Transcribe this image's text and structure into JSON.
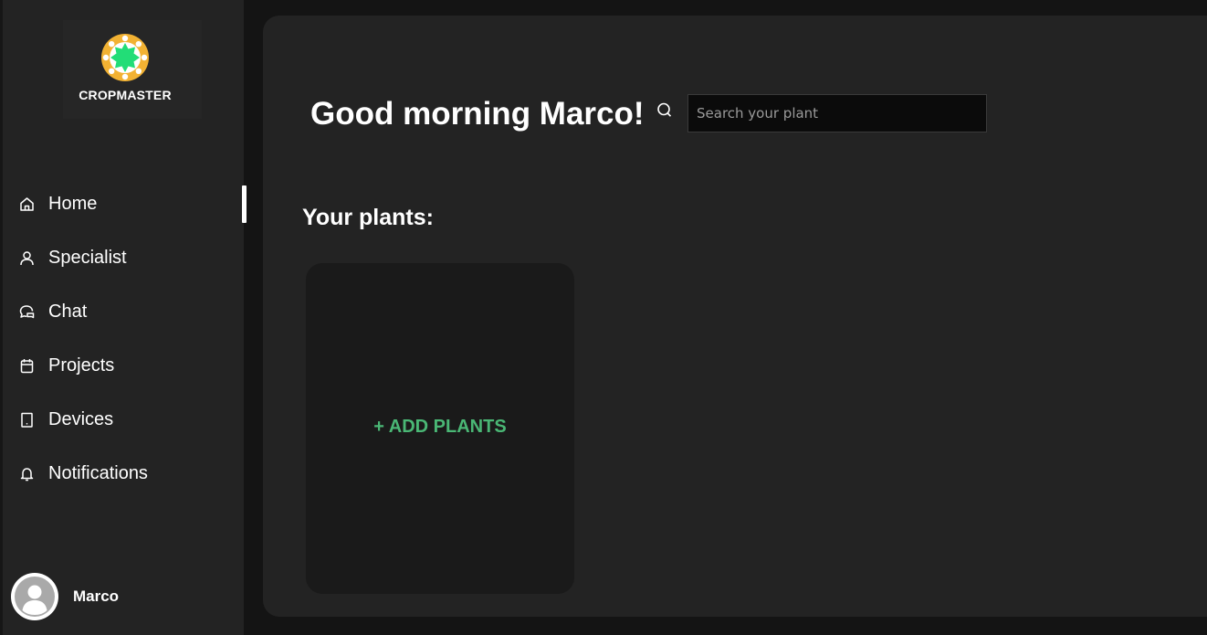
{
  "brand": {
    "name": "CROPMASTER",
    "logo_icon": "sun-flower-logo",
    "colors": {
      "outer": "#f2b233",
      "inner": "#22dd77",
      "ring": "#ffffff"
    }
  },
  "sidebar": {
    "items": [
      {
        "label": "Home",
        "icon": "home-icon",
        "active": true
      },
      {
        "label": "Specialist",
        "icon": "person-icon",
        "active": false
      },
      {
        "label": "Chat",
        "icon": "chat-icon",
        "active": false
      },
      {
        "label": "Projects",
        "icon": "calendar-icon",
        "active": false
      },
      {
        "label": "Devices",
        "icon": "tablet-icon",
        "active": false
      },
      {
        "label": "Notifications",
        "icon": "bell-icon",
        "active": false
      }
    ]
  },
  "user": {
    "name": "Marco",
    "avatar_icon": "user-avatar-icon"
  },
  "header": {
    "greeting": "Good morning Marco!",
    "search": {
      "placeholder": "Search your plant",
      "value": "",
      "icon": "search-icon"
    }
  },
  "plants": {
    "title": "Your plants:",
    "add_label": "+ ADD PLANTS",
    "accent": "#4ab775"
  }
}
